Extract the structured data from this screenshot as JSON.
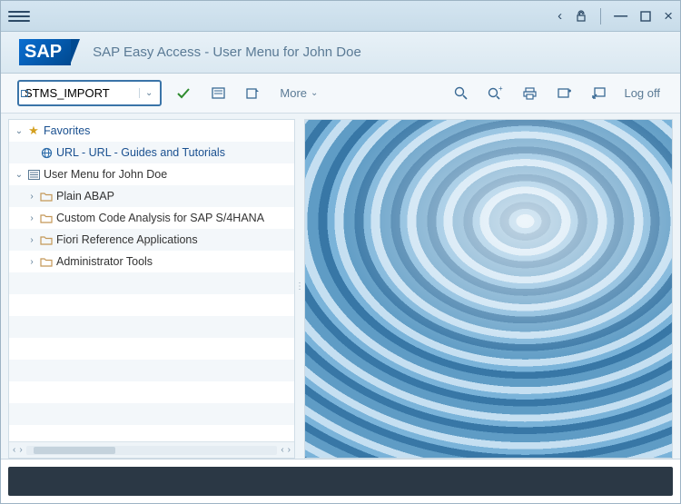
{
  "window": {
    "title": "SAP Easy Access  -  User Menu for John Doe"
  },
  "toolbar": {
    "command_value": "STMS_IMPORT",
    "more_label": "More",
    "logoff_label": "Log off"
  },
  "tree": {
    "favorites_label": "Favorites",
    "fav_items": [
      {
        "label": "URL - URL - Guides and Tutorials"
      }
    ],
    "user_menu_label": "User Menu for John Doe",
    "user_items": [
      {
        "label": "Plain ABAP"
      },
      {
        "label": "Custom Code Analysis for SAP S/4HANA"
      },
      {
        "label": "Fiori Reference Applications"
      },
      {
        "label": "Administrator Tools"
      }
    ]
  }
}
